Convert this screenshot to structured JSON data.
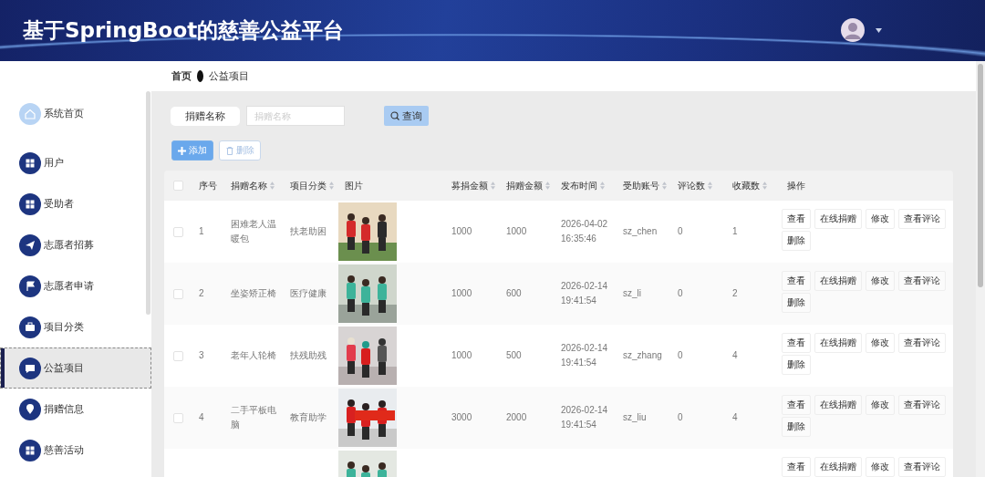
{
  "header": {
    "title": "基于SpringBoot的慈善公益平台"
  },
  "breadcrumb": [
    {
      "label": "首页",
      "current": false
    },
    {
      "label": "公益项目",
      "current": true
    }
  ],
  "sidebar": {
    "items": [
      {
        "label": "系统首页",
        "kind": "home",
        "selected": false
      },
      {
        "label": "用户",
        "kind": "menu",
        "selected": false
      },
      {
        "label": "受助者",
        "kind": "menu",
        "selected": false
      },
      {
        "label": "志愿者招募",
        "kind": "menu",
        "selected": false
      },
      {
        "label": "志愿者申请",
        "kind": "menu",
        "selected": false
      },
      {
        "label": "项目分类",
        "kind": "menu",
        "selected": false
      },
      {
        "label": "公益项目",
        "kind": "menu",
        "selected": true
      },
      {
        "label": "捐赠信息",
        "kind": "menu",
        "selected": false
      },
      {
        "label": "慈善活动",
        "kind": "menu",
        "selected": false
      }
    ]
  },
  "search": {
    "label": "捐赠名称",
    "placeholder": "捐赠名称",
    "button": "查询"
  },
  "toolbar": [
    {
      "label": "添加",
      "kind": "add",
      "disabled": false
    },
    {
      "label": "删除",
      "kind": "delete",
      "disabled": true
    }
  ],
  "table": {
    "select_all": {
      "checked": false
    },
    "columns": [
      {
        "label": "序号",
        "sortable": false
      },
      {
        "label": "捐赠名称",
        "sortable": true
      },
      {
        "label": "项目分类",
        "sortable": true
      },
      {
        "label": "图片",
        "sortable": false
      },
      {
        "label": "募捐金额",
        "sortable": true
      },
      {
        "label": "捐赠金额",
        "sortable": true
      },
      {
        "label": "发布时间",
        "sortable": true
      },
      {
        "label": "受助账号",
        "sortable": true
      },
      {
        "label": "评论数",
        "sortable": true
      },
      {
        "label": "收藏数",
        "sortable": true
      },
      {
        "label": "操作",
        "sortable": false
      }
    ],
    "rows": [
      {
        "checked": false,
        "index": "1",
        "name": "困难老人温暖包",
        "category": "扶老助困",
        "picture": {
          "kind": "picture"
        },
        "goal": "1000",
        "donated": "1000",
        "published": "2026-04-02 16:35:46",
        "account": "sz_chen",
        "comments": "0",
        "favorites": "1",
        "actions": [
          "查看",
          "在线捐赠",
          "修改",
          "查看评论",
          "删除"
        ]
      },
      {
        "checked": false,
        "index": "2",
        "name": "坐姿矫正椅",
        "category": "医疗健康",
        "picture": {
          "kind": "picture"
        },
        "goal": "1000",
        "donated": "600",
        "published": "2026-02-14 19:41:54",
        "account": "sz_li",
        "comments": "0",
        "favorites": "2",
        "actions": [
          "查看",
          "在线捐赠",
          "修改",
          "查看评论",
          "删除"
        ]
      },
      {
        "checked": false,
        "index": "3",
        "name": "老年人轮椅",
        "category": "扶残助残",
        "picture": {
          "kind": "picture"
        },
        "goal": "1000",
        "donated": "500",
        "published": "2026-02-14 19:41:54",
        "account": "sz_zhang",
        "comments": "0",
        "favorites": "4",
        "actions": [
          "查看",
          "在线捐赠",
          "修改",
          "查看评论",
          "删除"
        ]
      },
      {
        "checked": false,
        "index": "4",
        "name": "二手平板电脑",
        "category": "教育助学",
        "picture": {
          "kind": "picture"
        },
        "goal": "3000",
        "donated": "2000",
        "published": "2026-02-14 19:41:54",
        "account": "sz_liu",
        "comments": "0",
        "favorites": "4",
        "actions": [
          "查看",
          "在线捐赠",
          "修改",
          "查看评论",
          "删除"
        ]
      },
      {
        "picture": {
          "kind": "picture"
        },
        "actions": [
          "查看",
          "在线捐赠",
          "修改",
          "查看评论"
        ]
      }
    ]
  }
}
